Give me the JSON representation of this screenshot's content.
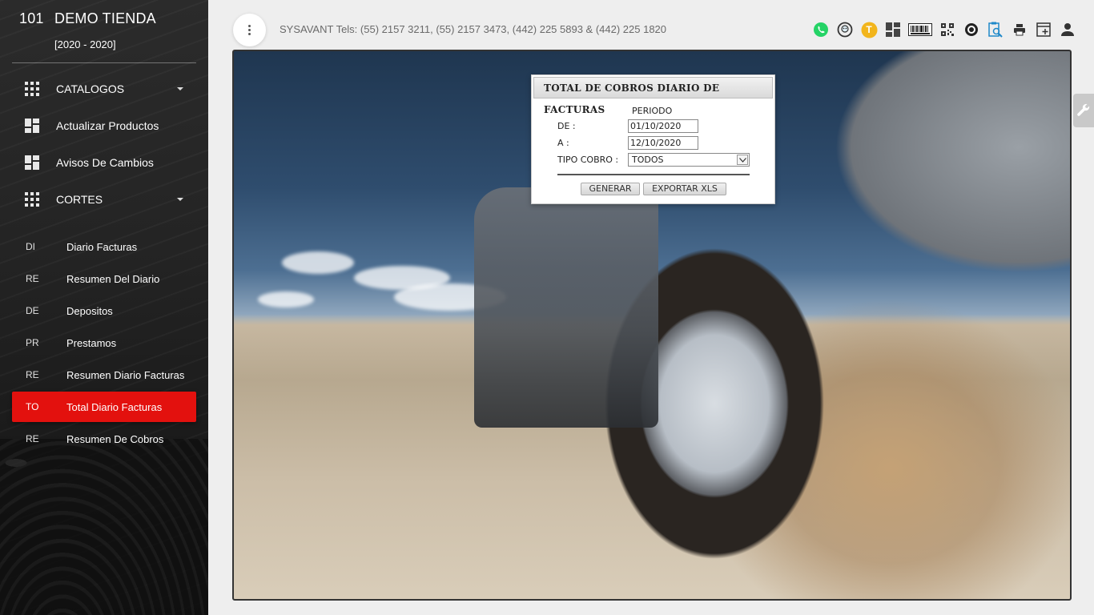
{
  "sidebar": {
    "store_number": "101",
    "store_name": "DEMO TIENDA",
    "years": "[2020 - 2020]",
    "nav": [
      {
        "label": "CATALOGOS",
        "icon": "apps-grid-icon"
      },
      {
        "label": "Actualizar Productos",
        "icon": "dashboard-icon"
      },
      {
        "label": "Avisos De Cambios",
        "icon": "dashboard-icon"
      },
      {
        "label": "CORTES",
        "icon": "apps-grid-icon"
      }
    ],
    "sub": [
      {
        "abbr": "DI",
        "label": "Diario Facturas"
      },
      {
        "abbr": "RE",
        "label": "Resumen Del Diario"
      },
      {
        "abbr": "DE",
        "label": "Depositos"
      },
      {
        "abbr": "PR",
        "label": "Prestamos"
      },
      {
        "abbr": "RE",
        "label": "Resumen Diario Facturas"
      },
      {
        "abbr": "TO",
        "label": "Total Diario Facturas"
      },
      {
        "abbr": "RE",
        "label": "Resumen De Cobros"
      }
    ]
  },
  "header": {
    "contact": "SYSAVANT Tels: (55) 2157 3211, (55) 2157 3473, (442) 225 5893 & (442) 225 1820",
    "toolbar": {
      "badge_letter": "T",
      "icons": [
        "whatsapp-icon",
        "support-icon",
        "user-badge-icon",
        "dashboard-icon",
        "barcode-icon",
        "qr-code-icon",
        "target-icon",
        "search-document-icon",
        "printer-icon",
        "new-window-icon",
        "account-icon"
      ]
    }
  },
  "dialog": {
    "title": "TOTAL DE COBROS DIARIO DE FACTURAS",
    "periodo": "PERIODO",
    "de_label": "DE :",
    "de_value": "01/10/2020",
    "a_label": "A :",
    "a_value": "12/10/2020",
    "tipo_label": "TIPO COBRO :",
    "tipo_value": "TODOS",
    "generar": "GENERAR",
    "exportar": "EXPORTAR XLS"
  },
  "colors": {
    "active": "#e3110e",
    "sidebar_bg": "#242424",
    "badge": "#f2b51c",
    "whatsapp": "#25d366"
  }
}
